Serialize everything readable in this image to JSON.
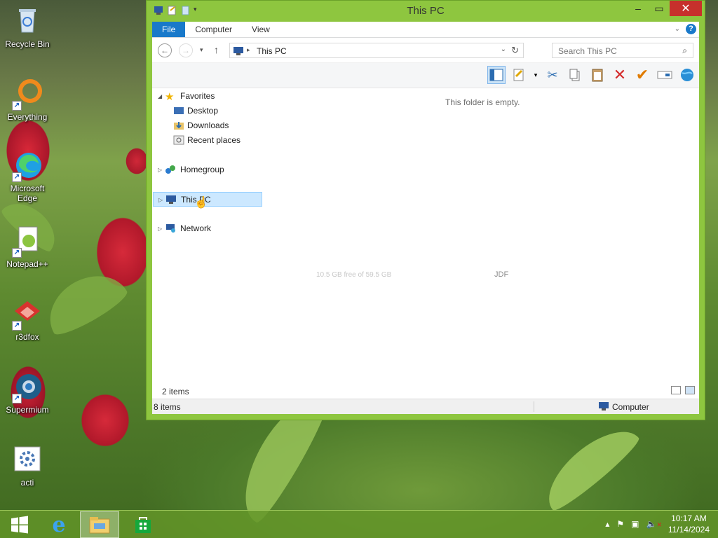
{
  "desktop": {
    "icons": [
      {
        "label": "Recycle Bin"
      },
      {
        "label": "Everything"
      },
      {
        "label": "Microsoft Edge"
      },
      {
        "label": "Notepad++"
      },
      {
        "label": "r3dfox"
      },
      {
        "label": "Supermium"
      },
      {
        "label": "acti"
      }
    ]
  },
  "window": {
    "title": "This PC",
    "ribbon_tabs": [
      "File",
      "Computer",
      "View"
    ],
    "address": "This PC",
    "search_placeholder": "Search This PC",
    "nav": {
      "favorites": "Favorites",
      "desktop": "Desktop",
      "downloads": "Downloads",
      "recent": "Recent places",
      "homegroup": "Homegroup",
      "this_pc": "This PC",
      "network": "Network"
    },
    "empty_message": "This folder is empty.",
    "ghost_text_left": "10.5 GB free of 59.5 GB",
    "ghost_text_right": "JDF",
    "item_count": "2 items",
    "status_left": "8 items",
    "status_right": "Computer"
  },
  "taskbar": {
    "time": "10:17 AM",
    "date": "11/14/2024"
  },
  "colors": {
    "window_frame": "#8ec63f",
    "accent": "#1979ca",
    "close": "#c7302c"
  }
}
